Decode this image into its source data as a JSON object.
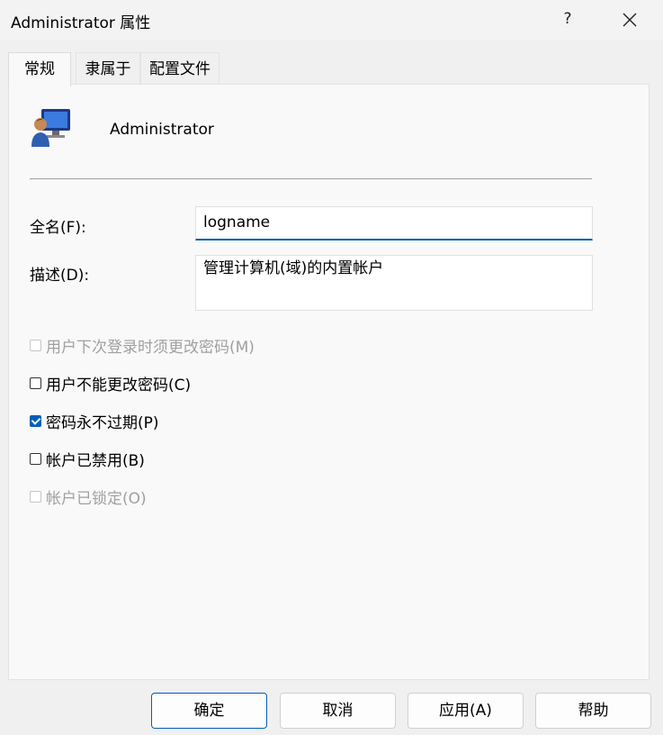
{
  "window": {
    "title": "Administrator 属性",
    "help": "?"
  },
  "tabs": [
    {
      "label": "常规",
      "active": true
    },
    {
      "label": "隶属于",
      "active": false
    },
    {
      "label": "配置文件",
      "active": false
    }
  ],
  "user": {
    "name": "Administrator",
    "icon": "user-computer-icon"
  },
  "fields": {
    "fullname_label": "全名(F):",
    "fullname_value": "logname",
    "desc_label": "描述(D):",
    "desc_value": "管理计算机(域)的内置帐户"
  },
  "checkboxes": [
    {
      "label": "用户下次登录时须更改密码(M)",
      "checked": false,
      "disabled": true
    },
    {
      "label": "用户不能更改密码(C)",
      "checked": false,
      "disabled": false
    },
    {
      "label": "密码永不过期(P)",
      "checked": true,
      "disabled": false
    },
    {
      "label": "帐户已禁用(B)",
      "checked": false,
      "disabled": false
    },
    {
      "label": "帐户已锁定(O)",
      "checked": false,
      "disabled": true
    }
  ],
  "buttons": {
    "ok": "确定",
    "cancel": "取消",
    "apply": "应用(A)",
    "help": "帮助"
  },
  "colors": {
    "accent": "#005fb8",
    "background": "#f0f0f0",
    "panel": "#f9f9f9"
  }
}
